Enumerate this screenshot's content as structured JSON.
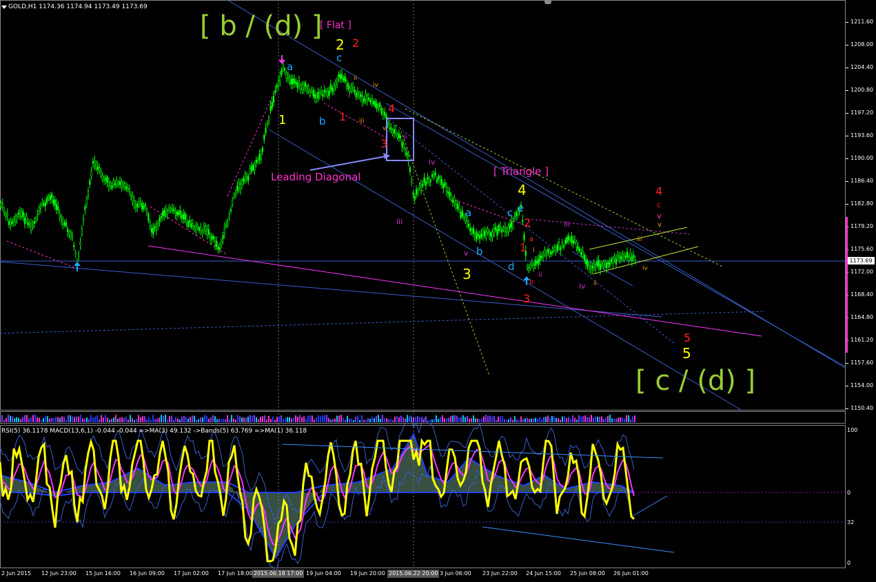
{
  "window": {
    "symbol_label": "GOLD,H1  1174.36 1174.94 1173.49 1173.69",
    "indicator_label": "RSI(5) 36.1178  MACD(13,6,1) -0.044 -0.044  =>MA(3) 49.132  ->Bands(5) 63.769  =>MA(1) 36.118",
    "current_price": "1173.69"
  },
  "price_axis": [
    "1211.60",
    "1208.00",
    "1204.40",
    "1200.80",
    "1197.20",
    "1193.60",
    "1190.00",
    "1186.40",
    "1182.80",
    "1179.20",
    "1175.60",
    "1172.00",
    "1168.40",
    "1164.80",
    "1161.20",
    "1157.60",
    "1154.00",
    "1150.40"
  ],
  "indicator_axis": [
    "100",
    "0",
    "32",
    "0"
  ],
  "time_axis": [
    "2 Jun 2015",
    "12 Jun 23:00",
    "15 Jun 16:00",
    "16 Jun 09:00",
    "17 Jun 02:00",
    "17 Jun 18:00",
    "2015.06.18 17:00",
    "19 Jun 04:00",
    "19 Jun 20:00",
    "2015.06.22 20:00",
    "3 Jun 06:00",
    "23 Jun 22:00",
    "24 Jun 15:00",
    "25 Jun 08:00",
    "26 Jun 01:00"
  ],
  "annotations": {
    "wave_b_d": "[ b / (d) ]",
    "wave_c_d": "[ c / (d) ]",
    "flat": "[ Flat ]",
    "triangle": "[ Triangle ]",
    "leading_diagonal": "Leading Diagonal",
    "y1": "1",
    "y2": "2",
    "y3": "3",
    "y4": "4",
    "y5": "5",
    "r1a": "1",
    "r2a": "2",
    "r3a": "3",
    "r4a": "4",
    "r1b": "1",
    "r2b": "2",
    "r3b": "3",
    "r4b": "4",
    "r5b": "5",
    "a1": "a",
    "b1": "b",
    "c1": "c",
    "a2": "a",
    "b2": "b",
    "c2": "c",
    "d2": "d",
    "e2": "e",
    "ii1": "ii",
    "iii1": "iii",
    "iv1": "iv",
    "v1": "v",
    "ii2": "ii",
    "iii2": "iii",
    "iv2": "iv",
    "v2": "v",
    "i3": "i",
    "ii3": "ii",
    "iii3": "iii",
    "iv3": "iv",
    "small_a": "a",
    "small_b": "b",
    "small_c": "c",
    "small_i": "i",
    "small_ii": "ii",
    "small_iii": "iii",
    "small_iv": "iv",
    "small_v": "v",
    "small_v2": "v",
    "small_i2": "i",
    "small_ii2": "ii",
    "small_iii2": "iii",
    "small_iv2": "iv",
    "small_ii3": "ii",
    "small_iii3": "iii",
    "small_iv3": "iv",
    "small_i4": "i",
    "small_ii4": "ii"
  },
  "colors": {
    "background": "#000000",
    "candle": "#00ff00",
    "wave_green": "#9acd32",
    "wave_yellow": "#ffff00",
    "wave_red": "#ff2020",
    "wave_cyan": "#1ea7ff",
    "wave_magenta": "#ff33cc",
    "wave_purple": "#cc33cc",
    "trendline": "#3a5fcd",
    "rsi": "#ffff00",
    "ma": "#ff33ff"
  }
}
